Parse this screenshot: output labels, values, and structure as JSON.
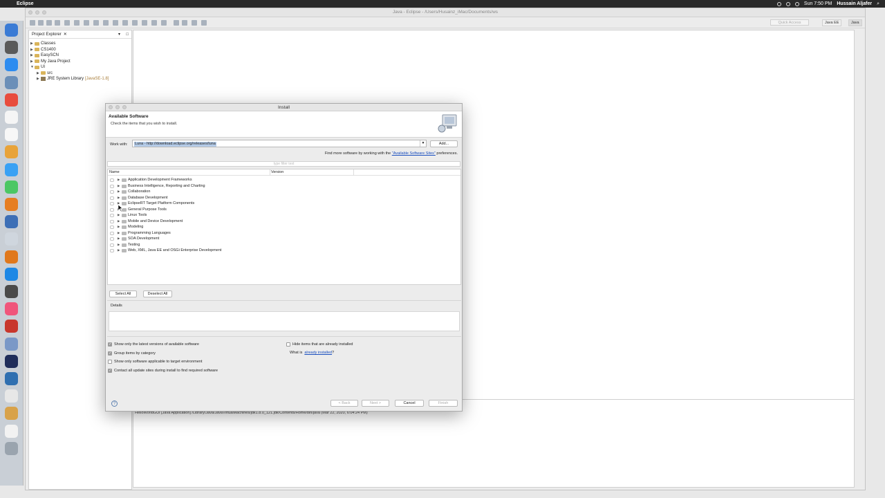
{
  "menubar": {
    "app_name": "Eclipse",
    "clock": "Sun 7:50 PM",
    "user": "Hussain Aljafer"
  },
  "window": {
    "title": "Java - Eclipse - /Users/Husainz_iMac/Documents/ws",
    "quick_access": "Quick Access",
    "perspective_javaee": "Java EE",
    "perspective_java": "Java"
  },
  "project_explorer": {
    "tab_label": "Project Explorer",
    "items": [
      {
        "label": "Classes",
        "twisty": "▶",
        "kind": "folder"
      },
      {
        "label": "CS1400",
        "twisty": "▶",
        "kind": "folder"
      },
      {
        "label": "EasySCN",
        "twisty": "▶",
        "kind": "folder"
      },
      {
        "label": "My Java Project",
        "twisty": "▶",
        "kind": "folder"
      },
      {
        "label": "UI",
        "twisty": "▼",
        "kind": "folder"
      },
      {
        "label": "src",
        "twisty": "▶",
        "kind": "src",
        "indent": 1
      },
      {
        "label": "JRE System Library",
        "suffix": "[JavaSE-1.8]",
        "twisty": "▶",
        "kind": "jar",
        "indent": 1
      }
    ]
  },
  "console": {
    "line": "HelloWorldGUI [Java Application] /Library/Java/JavaVirtualMachines/jdk1.8.0_121.jdk/Contents/Home/bin/java (Mar 22, 2020, 6:04:24 PM)"
  },
  "dialog": {
    "title": "Install",
    "heading": "Available Software",
    "subheading": "Check the items that you wish to install.",
    "work_with_label": "Work with:",
    "work_with_value": "Luna - http://download.eclipse.org/releases/luna",
    "add_button": "Add...",
    "find_more_prefix": "Find more software by working with the",
    "find_more_link": "\"Available Software Sites\"",
    "find_more_suffix": "preferences.",
    "filter_placeholder": "type filter text",
    "columns": {
      "name": "Name",
      "version": "Version"
    },
    "categories": [
      "Application Development Frameworks",
      "Business Intelligence, Reporting and Charting",
      "Collaboration",
      "Database Development",
      "EclipseRT Target Platform Components",
      "General Purpose Tools",
      "Linux Tools",
      "Mobile and Device Development",
      "Modeling",
      "Programming Languages",
      "SOA Development",
      "Testing",
      "Web, XML, Java EE and OSGi Enterprise Development"
    ],
    "select_all": "Select All",
    "deselect_all": "Deselect All",
    "details_label": "Details",
    "options": {
      "latest_versions": {
        "label": "Show only the latest versions of available software",
        "checked": true
      },
      "group_by_category": {
        "label": "Group items by category",
        "checked": true
      },
      "target_env": {
        "label": "Show only software applicable to target environment",
        "checked": false
      },
      "contact_sites": {
        "label": "Contact all update sites during install to find required software",
        "checked": true
      },
      "hide_installed": {
        "label": "Hide items that are already installed",
        "checked": false
      }
    },
    "what_is_prefix": "What is",
    "what_is_link": "already installed",
    "what_is_suffix": "?",
    "back_button": "< Back",
    "next_button": "Next >",
    "cancel_button": "Cancel",
    "finish_button": "Finish",
    "help_icon": "?"
  },
  "colors": {
    "menubar": "#2a2a2a",
    "link": "#1a4fbf",
    "selection": "#b4cbe8",
    "dock": "#c9cfd6"
  }
}
